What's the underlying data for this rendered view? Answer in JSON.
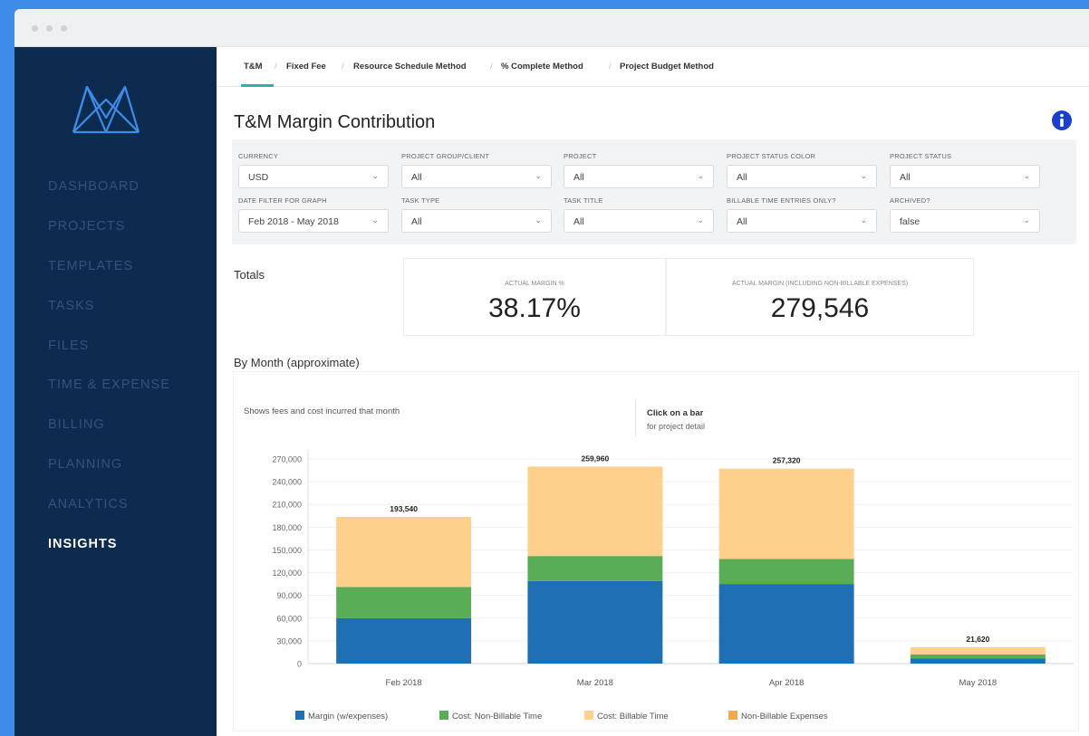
{
  "colors": {
    "sidebar_bg": "#0c2b4e",
    "accent_teal": "#26b3b0",
    "info_blue": "#1a3fc8",
    "margin": "#1f6fb4",
    "non_billable_time": "#5aad57",
    "billable_time": "#fdd08b",
    "non_billable_expenses": "#f2a94d"
  },
  "sidebar": {
    "logo": "mavenlink-logo-icon",
    "items": [
      {
        "label": "DASHBOARD"
      },
      {
        "label": "PROJECTS"
      },
      {
        "label": "TEMPLATES"
      },
      {
        "label": "TASKS"
      },
      {
        "label": "FILES"
      },
      {
        "label": "TIME & EXPENSE"
      },
      {
        "label": "BILLING"
      },
      {
        "label": "PLANNING"
      },
      {
        "label": "ANALYTICS"
      },
      {
        "label": "INSIGHTS",
        "active": true
      }
    ]
  },
  "tabs": [
    {
      "label": "T&M",
      "active": true
    },
    {
      "label": "Fixed Fee"
    },
    {
      "label": "Resource Schedule Method"
    },
    {
      "label": "% Complete Method"
    },
    {
      "label": "Project Budget Method"
    }
  ],
  "page": {
    "title": "T&M Margin Contribution",
    "info_icon": "info-circle-icon"
  },
  "filters": [
    {
      "label": "CURRENCY",
      "value": "USD"
    },
    {
      "label": "PROJECT GROUP/CLIENT",
      "value": "All"
    },
    {
      "label": "PROJECT",
      "value": "All"
    },
    {
      "label": "PROJECT STATUS COLOR",
      "value": "All"
    },
    {
      "label": "PROJECT STATUS",
      "value": "All"
    },
    {
      "label": "DATE FILTER FOR GRAPH",
      "value": "Feb 2018 - May 2018"
    },
    {
      "label": "TASK TYPE",
      "value": "All"
    },
    {
      "label": "TASK TITLE",
      "value": "All"
    },
    {
      "label": "BILLABLE TIME ENTRIES ONLY?",
      "value": "All"
    },
    {
      "label": "ARCHIVED?",
      "value": "false"
    }
  ],
  "totals": {
    "label": "Totals",
    "kpis": [
      {
        "label": "ACTUAL MARGIN %",
        "value": "38.17%"
      },
      {
        "label": "ACTUAL MARGIN (including non-billable expenses)",
        "value": "279,546"
      }
    ]
  },
  "by_month": {
    "label": "By Month (approximate)",
    "subtitle": "Shows fees and cost incurred that month",
    "note_title": "Click on a bar",
    "note_sub": "for project detail"
  },
  "chart_data": {
    "type": "bar",
    "stacked": true,
    "categories": [
      "Feb 2018",
      "Mar 2018",
      "Apr 2018",
      "May 2018"
    ],
    "series": [
      {
        "name": "Margin (w/expenses)",
        "color": "#1f6fb4",
        "values": [
          60000,
          109000,
          105000,
          7000
        ]
      },
      {
        "name": "Cost: Non-Billable Time",
        "color": "#5aad57",
        "values": [
          41000,
          33000,
          33000,
          5000
        ]
      },
      {
        "name": "Cost: Billable Time",
        "color": "#fdd08b",
        "values": [
          92540,
          117960,
          119320,
          9620
        ]
      },
      {
        "name": "Non-Billable Expenses",
        "color": "#f2a94d",
        "values": [
          0,
          0,
          0,
          0
        ]
      }
    ],
    "totals": [
      "193,540",
      "259,960",
      "257,320",
      "21,620"
    ],
    "ylim": [
      0,
      270000
    ],
    "yticks": [
      0,
      30000,
      60000,
      90000,
      120000,
      150000,
      180000,
      210000,
      240000,
      270000
    ],
    "ytick_labels": [
      "0",
      "30,000",
      "60,000",
      "90,000",
      "120,000",
      "150,000",
      "180,000",
      "210,000",
      "240,000",
      "270,000"
    ],
    "grid": true,
    "legend_position": "bottom"
  }
}
